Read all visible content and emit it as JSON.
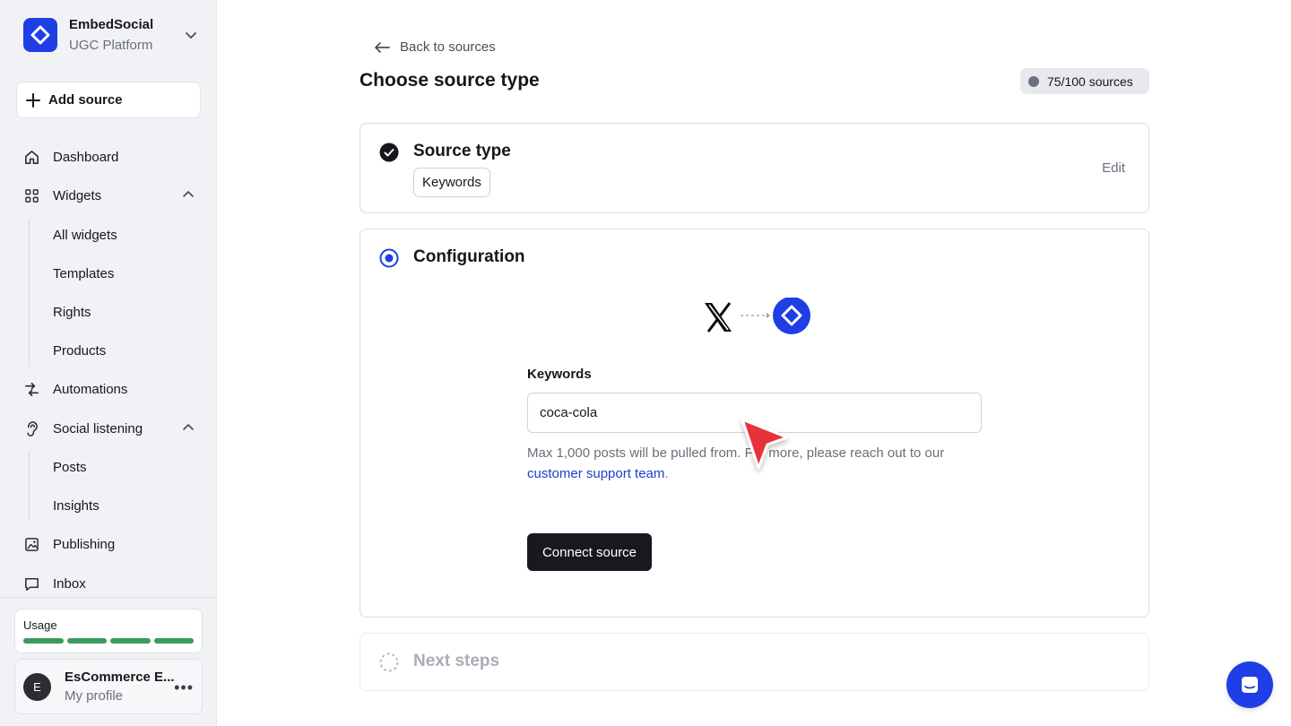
{
  "brand": {
    "name": "EmbedSocial",
    "subtitle": "UGC Platform"
  },
  "sidebar": {
    "add_source": "Add source",
    "items": [
      {
        "label": "Dashboard"
      },
      {
        "label": "Widgets"
      },
      {
        "label": "All widgets"
      },
      {
        "label": "Templates"
      },
      {
        "label": "Rights"
      },
      {
        "label": "Products"
      },
      {
        "label": "Automations"
      },
      {
        "label": "Social listening"
      },
      {
        "label": "Posts"
      },
      {
        "label": "Insights"
      },
      {
        "label": "Publishing"
      },
      {
        "label": "Inbox"
      }
    ],
    "usage_label": "Usage",
    "profile": {
      "initial": "E",
      "name": "EsCommerce E...",
      "sub": "My profile"
    }
  },
  "header": {
    "back_label": "Back to sources",
    "title": "Choose source type",
    "badge": "75/100 sources"
  },
  "steps": {
    "source_type": {
      "title": "Source type",
      "value": "Keywords",
      "edit": "Edit"
    },
    "configuration": {
      "title": "Configuration",
      "field_label": "Keywords",
      "field_value": "coca-cola",
      "helper_text": "Max 1,000 posts will be pulled from. For more, please reach out to our",
      "helper_link": "customer support team",
      "helper_end": ".",
      "button": "Connect source"
    },
    "next": {
      "title": "Next steps"
    }
  },
  "colors": {
    "accent": "#1f3ee5",
    "usage_bar": "#3d9a5f",
    "cursor": "#e8323a"
  }
}
